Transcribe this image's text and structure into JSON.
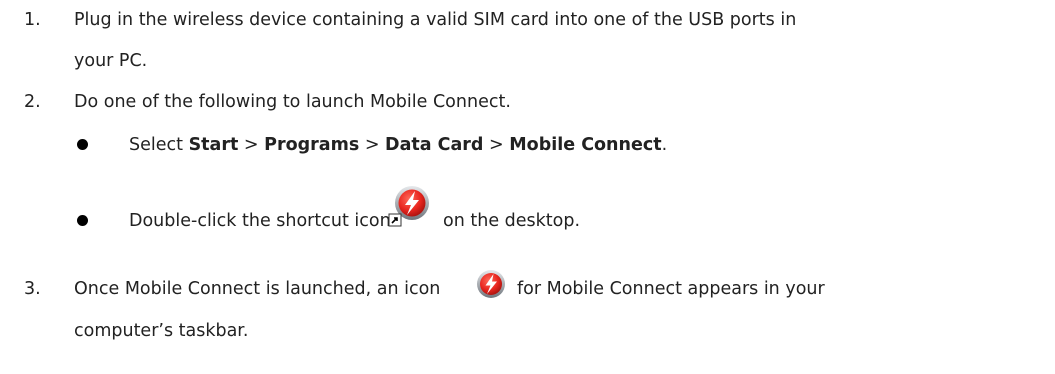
{
  "steps": [
    {
      "number": "1.",
      "line1": "Plug in the wireless device containing a valid SIM card into one of the USB ports in",
      "line2": "your PC."
    },
    {
      "number": "2.",
      "text": "Do one of the following to launch Mobile Connect.",
      "bullets": [
        {
          "prefix": "Select ",
          "path": [
            "Start",
            "Programs",
            "Data Card",
            "Mobile Connect"
          ],
          "separator": " > ",
          "suffix": "."
        },
        {
          "before_icon": "Double-click the shortcut icon",
          "icon": "mobile-connect-shortcut-icon",
          "after_icon": "on the desktop."
        }
      ]
    },
    {
      "number": "3.",
      "before_icon": "Once Mobile Connect is launched, an icon",
      "icon": "mobile-connect-tray-icon",
      "after_icon": "for Mobile Connect appears in your",
      "line2": "computer’s taskbar."
    }
  ],
  "colors": {
    "text": "#222222",
    "icon_red": "#e8261f",
    "icon_gray": "#8a8f96"
  }
}
